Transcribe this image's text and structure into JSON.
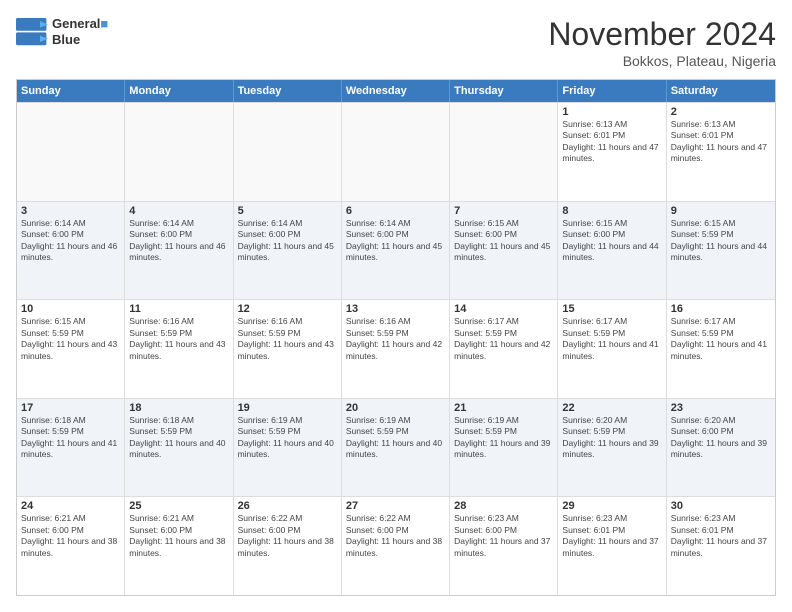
{
  "header": {
    "logo_line1": "General",
    "logo_line2": "Blue",
    "month_title": "November 2024",
    "location": "Bokkos, Plateau, Nigeria"
  },
  "weekdays": [
    "Sunday",
    "Monday",
    "Tuesday",
    "Wednesday",
    "Thursday",
    "Friday",
    "Saturday"
  ],
  "rows": [
    [
      {
        "day": "",
        "empty": true
      },
      {
        "day": "",
        "empty": true
      },
      {
        "day": "",
        "empty": true
      },
      {
        "day": "",
        "empty": true
      },
      {
        "day": "",
        "empty": true
      },
      {
        "day": "1",
        "sunrise": "6:13 AM",
        "sunset": "6:01 PM",
        "daylight": "11 hours and 47 minutes."
      },
      {
        "day": "2",
        "sunrise": "6:13 AM",
        "sunset": "6:01 PM",
        "daylight": "11 hours and 47 minutes."
      }
    ],
    [
      {
        "day": "3",
        "sunrise": "6:14 AM",
        "sunset": "6:00 PM",
        "daylight": "11 hours and 46 minutes."
      },
      {
        "day": "4",
        "sunrise": "6:14 AM",
        "sunset": "6:00 PM",
        "daylight": "11 hours and 46 minutes."
      },
      {
        "day": "5",
        "sunrise": "6:14 AM",
        "sunset": "6:00 PM",
        "daylight": "11 hours and 45 minutes."
      },
      {
        "day": "6",
        "sunrise": "6:14 AM",
        "sunset": "6:00 PM",
        "daylight": "11 hours and 45 minutes."
      },
      {
        "day": "7",
        "sunrise": "6:15 AM",
        "sunset": "6:00 PM",
        "daylight": "11 hours and 45 minutes."
      },
      {
        "day": "8",
        "sunrise": "6:15 AM",
        "sunset": "6:00 PM",
        "daylight": "11 hours and 44 minutes."
      },
      {
        "day": "9",
        "sunrise": "6:15 AM",
        "sunset": "5:59 PM",
        "daylight": "11 hours and 44 minutes."
      }
    ],
    [
      {
        "day": "10",
        "sunrise": "6:15 AM",
        "sunset": "5:59 PM",
        "daylight": "11 hours and 43 minutes."
      },
      {
        "day": "11",
        "sunrise": "6:16 AM",
        "sunset": "5:59 PM",
        "daylight": "11 hours and 43 minutes."
      },
      {
        "day": "12",
        "sunrise": "6:16 AM",
        "sunset": "5:59 PM",
        "daylight": "11 hours and 43 minutes."
      },
      {
        "day": "13",
        "sunrise": "6:16 AM",
        "sunset": "5:59 PM",
        "daylight": "11 hours and 42 minutes."
      },
      {
        "day": "14",
        "sunrise": "6:17 AM",
        "sunset": "5:59 PM",
        "daylight": "11 hours and 42 minutes."
      },
      {
        "day": "15",
        "sunrise": "6:17 AM",
        "sunset": "5:59 PM",
        "daylight": "11 hours and 41 minutes."
      },
      {
        "day": "16",
        "sunrise": "6:17 AM",
        "sunset": "5:59 PM",
        "daylight": "11 hours and 41 minutes."
      }
    ],
    [
      {
        "day": "17",
        "sunrise": "6:18 AM",
        "sunset": "5:59 PM",
        "daylight": "11 hours and 41 minutes."
      },
      {
        "day": "18",
        "sunrise": "6:18 AM",
        "sunset": "5:59 PM",
        "daylight": "11 hours and 40 minutes."
      },
      {
        "day": "19",
        "sunrise": "6:19 AM",
        "sunset": "5:59 PM",
        "daylight": "11 hours and 40 minutes."
      },
      {
        "day": "20",
        "sunrise": "6:19 AM",
        "sunset": "5:59 PM",
        "daylight": "11 hours and 40 minutes."
      },
      {
        "day": "21",
        "sunrise": "6:19 AM",
        "sunset": "5:59 PM",
        "daylight": "11 hours and 39 minutes."
      },
      {
        "day": "22",
        "sunrise": "6:20 AM",
        "sunset": "5:59 PM",
        "daylight": "11 hours and 39 minutes."
      },
      {
        "day": "23",
        "sunrise": "6:20 AM",
        "sunset": "6:00 PM",
        "daylight": "11 hours and 39 minutes."
      }
    ],
    [
      {
        "day": "24",
        "sunrise": "6:21 AM",
        "sunset": "6:00 PM",
        "daylight": "11 hours and 38 minutes."
      },
      {
        "day": "25",
        "sunrise": "6:21 AM",
        "sunset": "6:00 PM",
        "daylight": "11 hours and 38 minutes."
      },
      {
        "day": "26",
        "sunrise": "6:22 AM",
        "sunset": "6:00 PM",
        "daylight": "11 hours and 38 minutes."
      },
      {
        "day": "27",
        "sunrise": "6:22 AM",
        "sunset": "6:00 PM",
        "daylight": "11 hours and 38 minutes."
      },
      {
        "day": "28",
        "sunrise": "6:23 AM",
        "sunset": "6:00 PM",
        "daylight": "11 hours and 37 minutes."
      },
      {
        "day": "29",
        "sunrise": "6:23 AM",
        "sunset": "6:01 PM",
        "daylight": "11 hours and 37 minutes."
      },
      {
        "day": "30",
        "sunrise": "6:23 AM",
        "sunset": "6:01 PM",
        "daylight": "11 hours and 37 minutes."
      }
    ]
  ]
}
